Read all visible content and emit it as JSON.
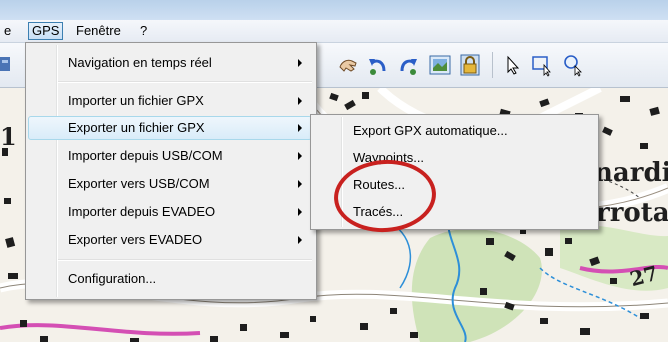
{
  "menubar": {
    "partial_label": "e",
    "gps_label": "GPS",
    "fenetre_label": "Fenêtre",
    "help_label": "?"
  },
  "gps_menu": {
    "items": [
      {
        "label": "Navigation en temps réel",
        "submenu": true
      },
      {
        "label": "Importer un fichier GPX",
        "submenu": true
      },
      {
        "label": "Exporter un fichier GPX",
        "submenu": true,
        "highlighted": true
      },
      {
        "label": "Importer depuis USB/COM",
        "submenu": true
      },
      {
        "label": "Exporter vers USB/COM",
        "submenu": true
      },
      {
        "label": "Importer depuis EVADEO",
        "submenu": true
      },
      {
        "label": "Exporter vers EVADEO",
        "submenu": true
      },
      {
        "label": "Configuration...",
        "submenu": false
      }
    ]
  },
  "export_submenu": {
    "items": [
      {
        "label": "Export GPX automatique..."
      },
      {
        "label": "Waypoints..."
      },
      {
        "label": "Routes..."
      },
      {
        "label": "Tracés..."
      }
    ]
  },
  "map": {
    "labels": [
      "1",
      "nardil",
      "rrota,",
      "27"
    ]
  },
  "colors": {
    "highlight_circle": "#c8211f",
    "menu_bg": "#f0f0f0",
    "map_bg": "#f4f1ea"
  },
  "toolbar_icons": [
    "hand-icon",
    "undo-icon",
    "redo-icon",
    "map-view-icon",
    "lock-icon",
    "pointer-icon",
    "select-rect-icon",
    "zoom-icon"
  ]
}
